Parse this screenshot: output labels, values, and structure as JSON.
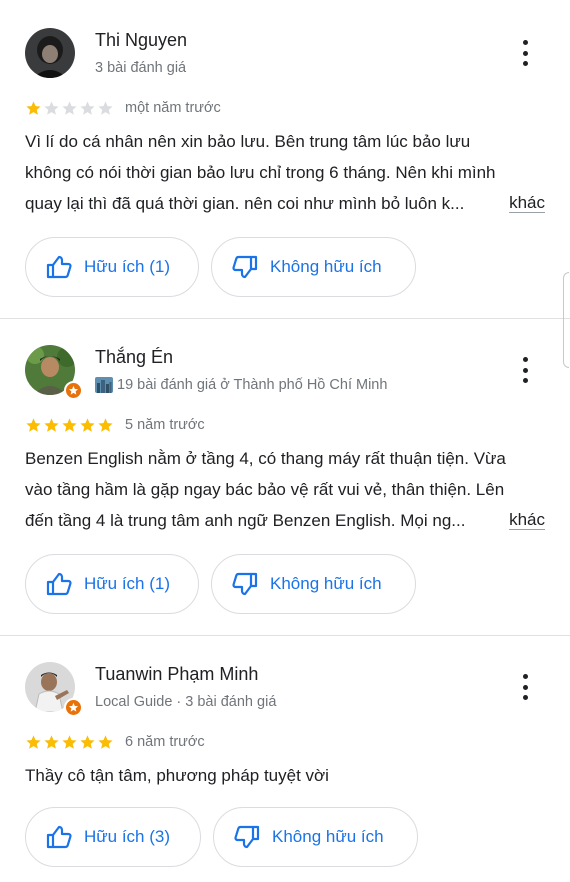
{
  "reviews": [
    {
      "name": "Thi Nguyen",
      "meta": "3 bài đánh giá",
      "rating": 1,
      "time": "một năm trước",
      "text_lines": [
        "Vì lí do cá nhân nên xin bảo lưu. Bên trung tâm lúc bảo lưu",
        "không có nói thời gian bảo lưu chỉ trong 6 tháng. Nên khi mình",
        "quay lại thì đã quá thời gian. nên coi như mình bỏ luôn k..."
      ],
      "more_label": "khác",
      "helpful_label": "Hữu ích (1)",
      "not_helpful_label": "Không hữu ích"
    },
    {
      "name": "Thắng Én",
      "meta": "19 bài đánh giá ở Thành phố Hồ Chí Minh",
      "rating": 5,
      "time": "5 năm trước",
      "text_lines": [
        "Benzen English nằm ở tầng 4, có thang máy rất thuận tiện. Vừa",
        "vào tầng hầm là gặp ngay bác bảo vệ rất vui vẻ, thân thiện. Lên",
        "đến tầng 4 là trung tâm anh ngữ Benzen English. Mọi ng..."
      ],
      "more_label": "khác",
      "helpful_label": "Hữu ích (1)",
      "not_helpful_label": "Không hữu ích"
    },
    {
      "name": "Tuanwin Phạm Minh",
      "meta": "Local Guide · 3 bài đánh giá",
      "rating": 5,
      "time": "6 năm trước",
      "text_lines": [
        "Thầy cô tận tâm, phương pháp tuyệt vời"
      ],
      "helpful_label": "Hữu ích (3)",
      "not_helpful_label": "Không hữu ích"
    }
  ],
  "colors": {
    "star_filled": "#fbbc04",
    "star_empty": "#dadce0",
    "accent": "#1a73e8",
    "local_guide_badge": "#e8710a"
  },
  "icons": [
    "more-vert-icon",
    "star-icon",
    "thumb-up-icon",
    "thumb-down-icon",
    "local-guide-badge-icon",
    "city-icon"
  ]
}
